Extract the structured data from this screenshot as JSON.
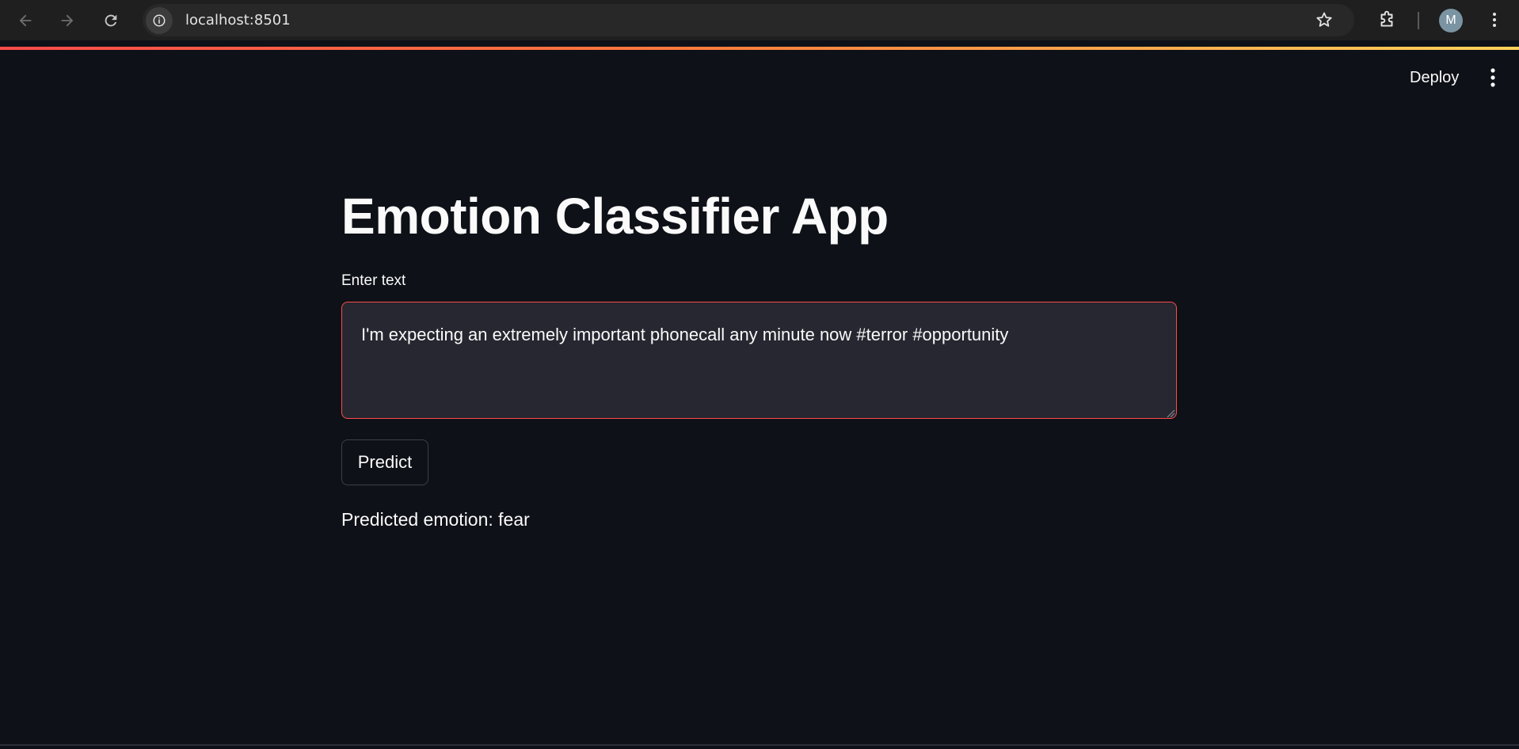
{
  "browser": {
    "url": "localhost:8501",
    "profile_initial": "M"
  },
  "header": {
    "deploy_label": "Deploy"
  },
  "main": {
    "title": "Emotion Classifier App",
    "input_label": "Enter text",
    "input_value": "I'm expecting an extremely important phonecall any minute now #terror #opportunity",
    "predict_label": "Predict",
    "result": "Predicted emotion: fear"
  },
  "colors": {
    "background": "#0e1117",
    "accent": "#ff4b4b",
    "input_background": "#262730",
    "text": "#fafafa"
  },
  "icons": {
    "back": "arrow-left-icon",
    "forward": "arrow-right-icon",
    "reload": "reload-icon",
    "site_info": "info-icon",
    "bookmark": "star-icon",
    "extensions": "puzzle-icon",
    "browser_menu": "kebab-menu-icon",
    "app_menu": "kebab-menu-icon"
  }
}
